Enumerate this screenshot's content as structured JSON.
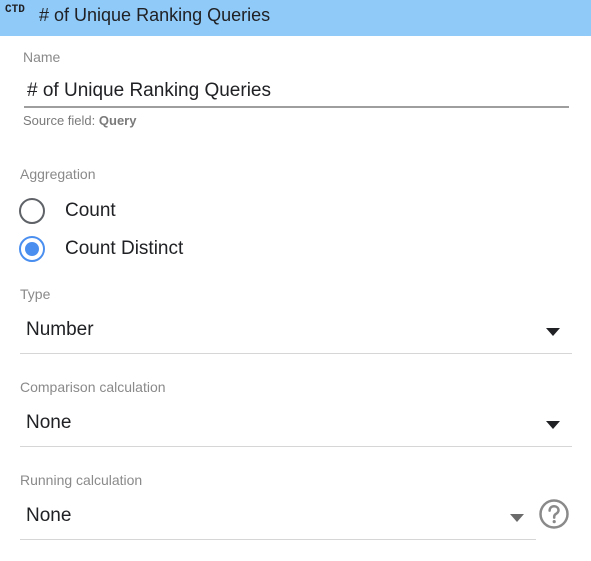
{
  "header": {
    "badge": "CTD",
    "title": "# of Unique Ranking Queries",
    "background_color": "#90caf9"
  },
  "name_field": {
    "label": "Name",
    "value": "# of Unique Ranking Queries",
    "source_prefix": "Source field:",
    "source_value": "Query"
  },
  "aggregation": {
    "label": "Aggregation",
    "options": [
      {
        "label": "Count",
        "selected": false
      },
      {
        "label": "Count Distinct",
        "selected": true
      }
    ],
    "accent_color": "#4a8ff0"
  },
  "type_field": {
    "label": "Type",
    "value": "Number",
    "icon": "chevron-down-icon"
  },
  "comparison_field": {
    "label": "Comparison calculation",
    "value": "None",
    "icon": "chevron-down-icon"
  },
  "running_field": {
    "label": "Running calculation",
    "value": "None",
    "icon": "chevron-down-icon",
    "help_icon": "help-circle-icon"
  }
}
